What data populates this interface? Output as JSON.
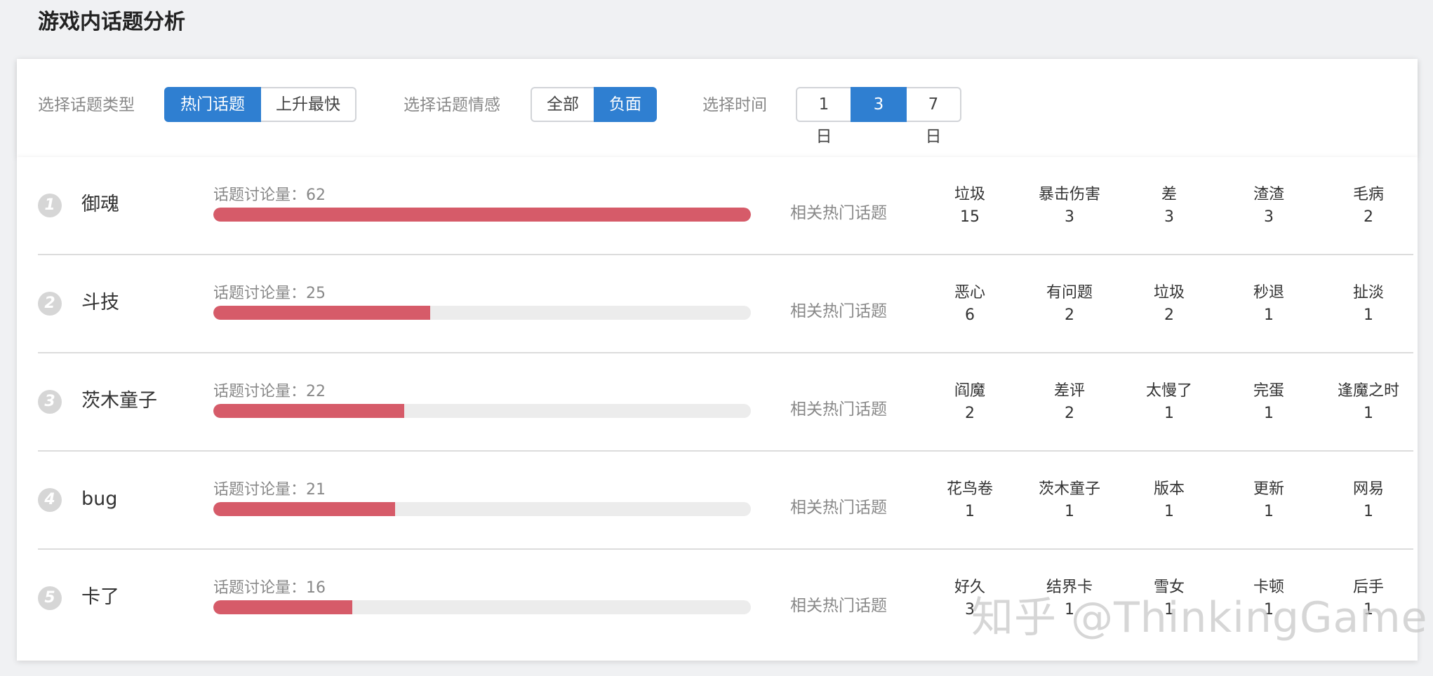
{
  "page_title": "游戏内话题分析",
  "filters": {
    "type": {
      "label": "选择话题类型",
      "options": [
        {
          "label": "热门话题",
          "active": true
        },
        {
          "label": "上升最快",
          "active": false
        }
      ]
    },
    "sentiment": {
      "label": "选择话题情感",
      "options": [
        {
          "label": "全部",
          "active": false
        },
        {
          "label": "负面",
          "active": true
        }
      ]
    },
    "time": {
      "label": "选择时间",
      "options": [
        {
          "label": "1日",
          "active": false
        },
        {
          "label": "3日",
          "active": true
        },
        {
          "label": "7日",
          "active": false
        }
      ]
    }
  },
  "discuss_prefix": "话题讨论量：",
  "related_label": "相关热门话题",
  "max_count": 62,
  "colors": {
    "accent": "#2f7fd1",
    "bar": "#d65b69",
    "track": "#ececec"
  },
  "topics": [
    {
      "rank": "1",
      "name": "御魂",
      "count": 62,
      "related": [
        {
          "name": "垃圾",
          "count": "15"
        },
        {
          "name": "暴击伤害",
          "count": "3"
        },
        {
          "name": "差",
          "count": "3"
        },
        {
          "name": "渣渣",
          "count": "3"
        },
        {
          "name": "毛病",
          "count": "2"
        }
      ]
    },
    {
      "rank": "2",
      "name": "斗技",
      "count": 25,
      "related": [
        {
          "name": "恶心",
          "count": "6"
        },
        {
          "name": "有问题",
          "count": "2"
        },
        {
          "name": "垃圾",
          "count": "2"
        },
        {
          "name": "秒退",
          "count": "1"
        },
        {
          "name": "扯淡",
          "count": "1"
        }
      ]
    },
    {
      "rank": "3",
      "name": "茨木童子",
      "count": 22,
      "related": [
        {
          "name": "阎魔",
          "count": "2"
        },
        {
          "name": "差评",
          "count": "2"
        },
        {
          "name": "太慢了",
          "count": "1"
        },
        {
          "name": "完蛋",
          "count": "1"
        },
        {
          "name": "逢魔之时",
          "count": "1"
        }
      ]
    },
    {
      "rank": "4",
      "name": "bug",
      "count": 21,
      "related": [
        {
          "name": "花鸟卷",
          "count": "1"
        },
        {
          "name": "茨木童子",
          "count": "1"
        },
        {
          "name": "版本",
          "count": "1"
        },
        {
          "name": "更新",
          "count": "1"
        },
        {
          "name": "网易",
          "count": "1"
        }
      ]
    },
    {
      "rank": "5",
      "name": "卡了",
      "count": 16,
      "related": [
        {
          "name": "好久",
          "count": "3"
        },
        {
          "name": "结界卡",
          "count": "1"
        },
        {
          "name": "雪女",
          "count": "1"
        },
        {
          "name": "卡顿",
          "count": "1"
        },
        {
          "name": "后手",
          "count": "1"
        }
      ]
    }
  ],
  "watermark": "知乎 @ThinkingGame"
}
